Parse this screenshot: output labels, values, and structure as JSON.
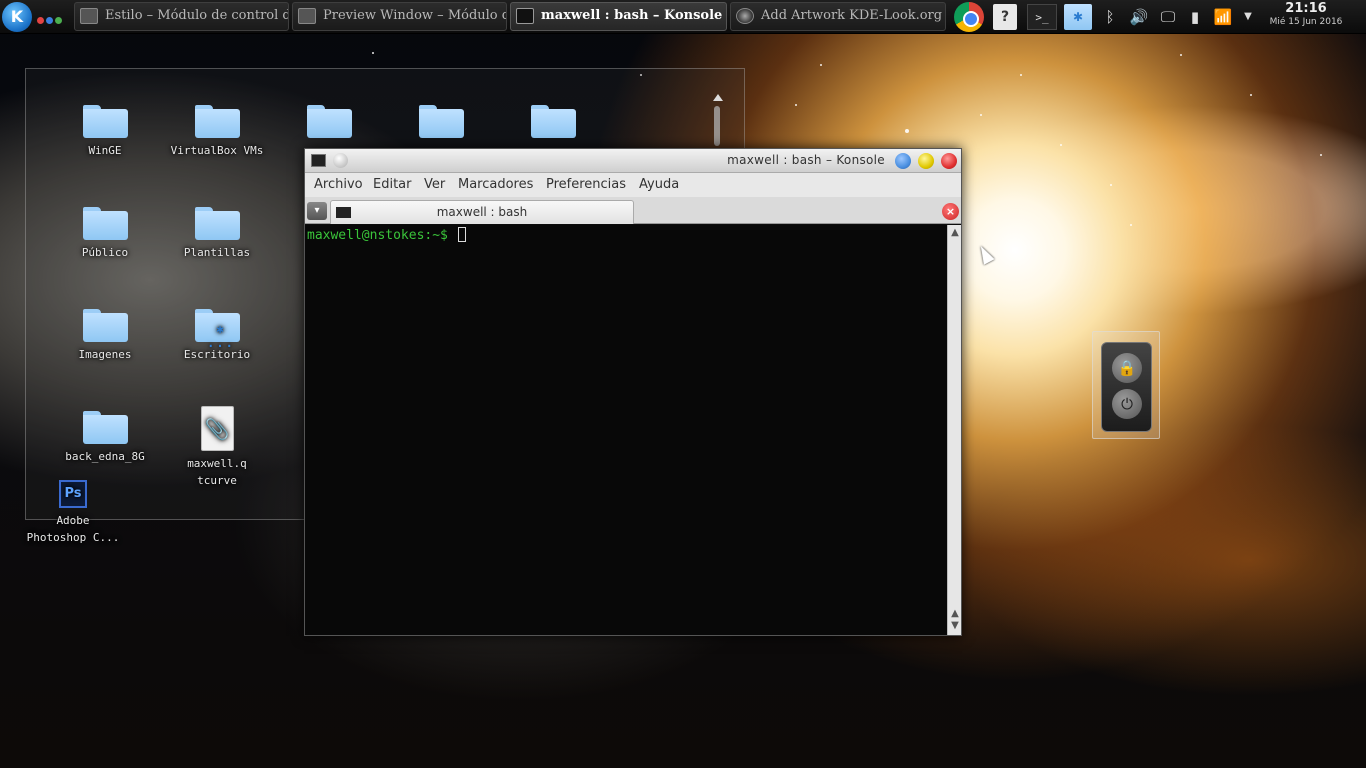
{
  "panel": {
    "launcher_icon": "kde-k-icon",
    "pager_colors": [
      "#e24343",
      "#3a7fe0",
      "#4caf50"
    ],
    "tasks": [
      {
        "label": "Estilo – Módulo de control d",
        "active": false
      },
      {
        "label": "Preview Window – Módulo de",
        "active": false
      },
      {
        "label": "maxwell : bash – Konsole",
        "active": true
      },
      {
        "label": "Add Artwork KDE-Look.org",
        "active": false
      }
    ],
    "tray": {
      "help_label": "?",
      "terminal_label": ">_"
    },
    "clock": {
      "time": "21:16",
      "date": "Mié 15 Jun 2016"
    }
  },
  "desktop": {
    "icons": [
      {
        "label": "WinGE",
        "type": "folder"
      },
      {
        "label": "VirtualBox VMs",
        "type": "folder"
      },
      {
        "label": "Público",
        "type": "folder"
      },
      {
        "label": "Plantillas",
        "type": "folder"
      },
      {
        "label": "Imagenes",
        "type": "folder"
      },
      {
        "label": "Escritorio",
        "type": "folder-kde"
      },
      {
        "label": "back_edna_8G",
        "type": "folder"
      },
      {
        "label": "maxwell.qtcurve",
        "type": "file"
      },
      {
        "label": "Adobe Photoshop C...",
        "type": "photoshop"
      }
    ],
    "photoshop_glyph": "Ps"
  },
  "konsole": {
    "title": "maxwell : bash – Konsole",
    "menu": [
      "Archivo",
      "Editar",
      "Ver",
      "Marcadores",
      "Preferencias",
      "Ayuda"
    ],
    "tab_label": "maxwell : bash",
    "prompt": "maxwell@nstokes:~$ ",
    "button_colors": {
      "minimize": "#4a8fe0",
      "maximize": "#e0c800",
      "close": "#e03030"
    }
  },
  "lock_widget": {
    "lock_icon": "🔒",
    "power_icon": "⏻"
  }
}
